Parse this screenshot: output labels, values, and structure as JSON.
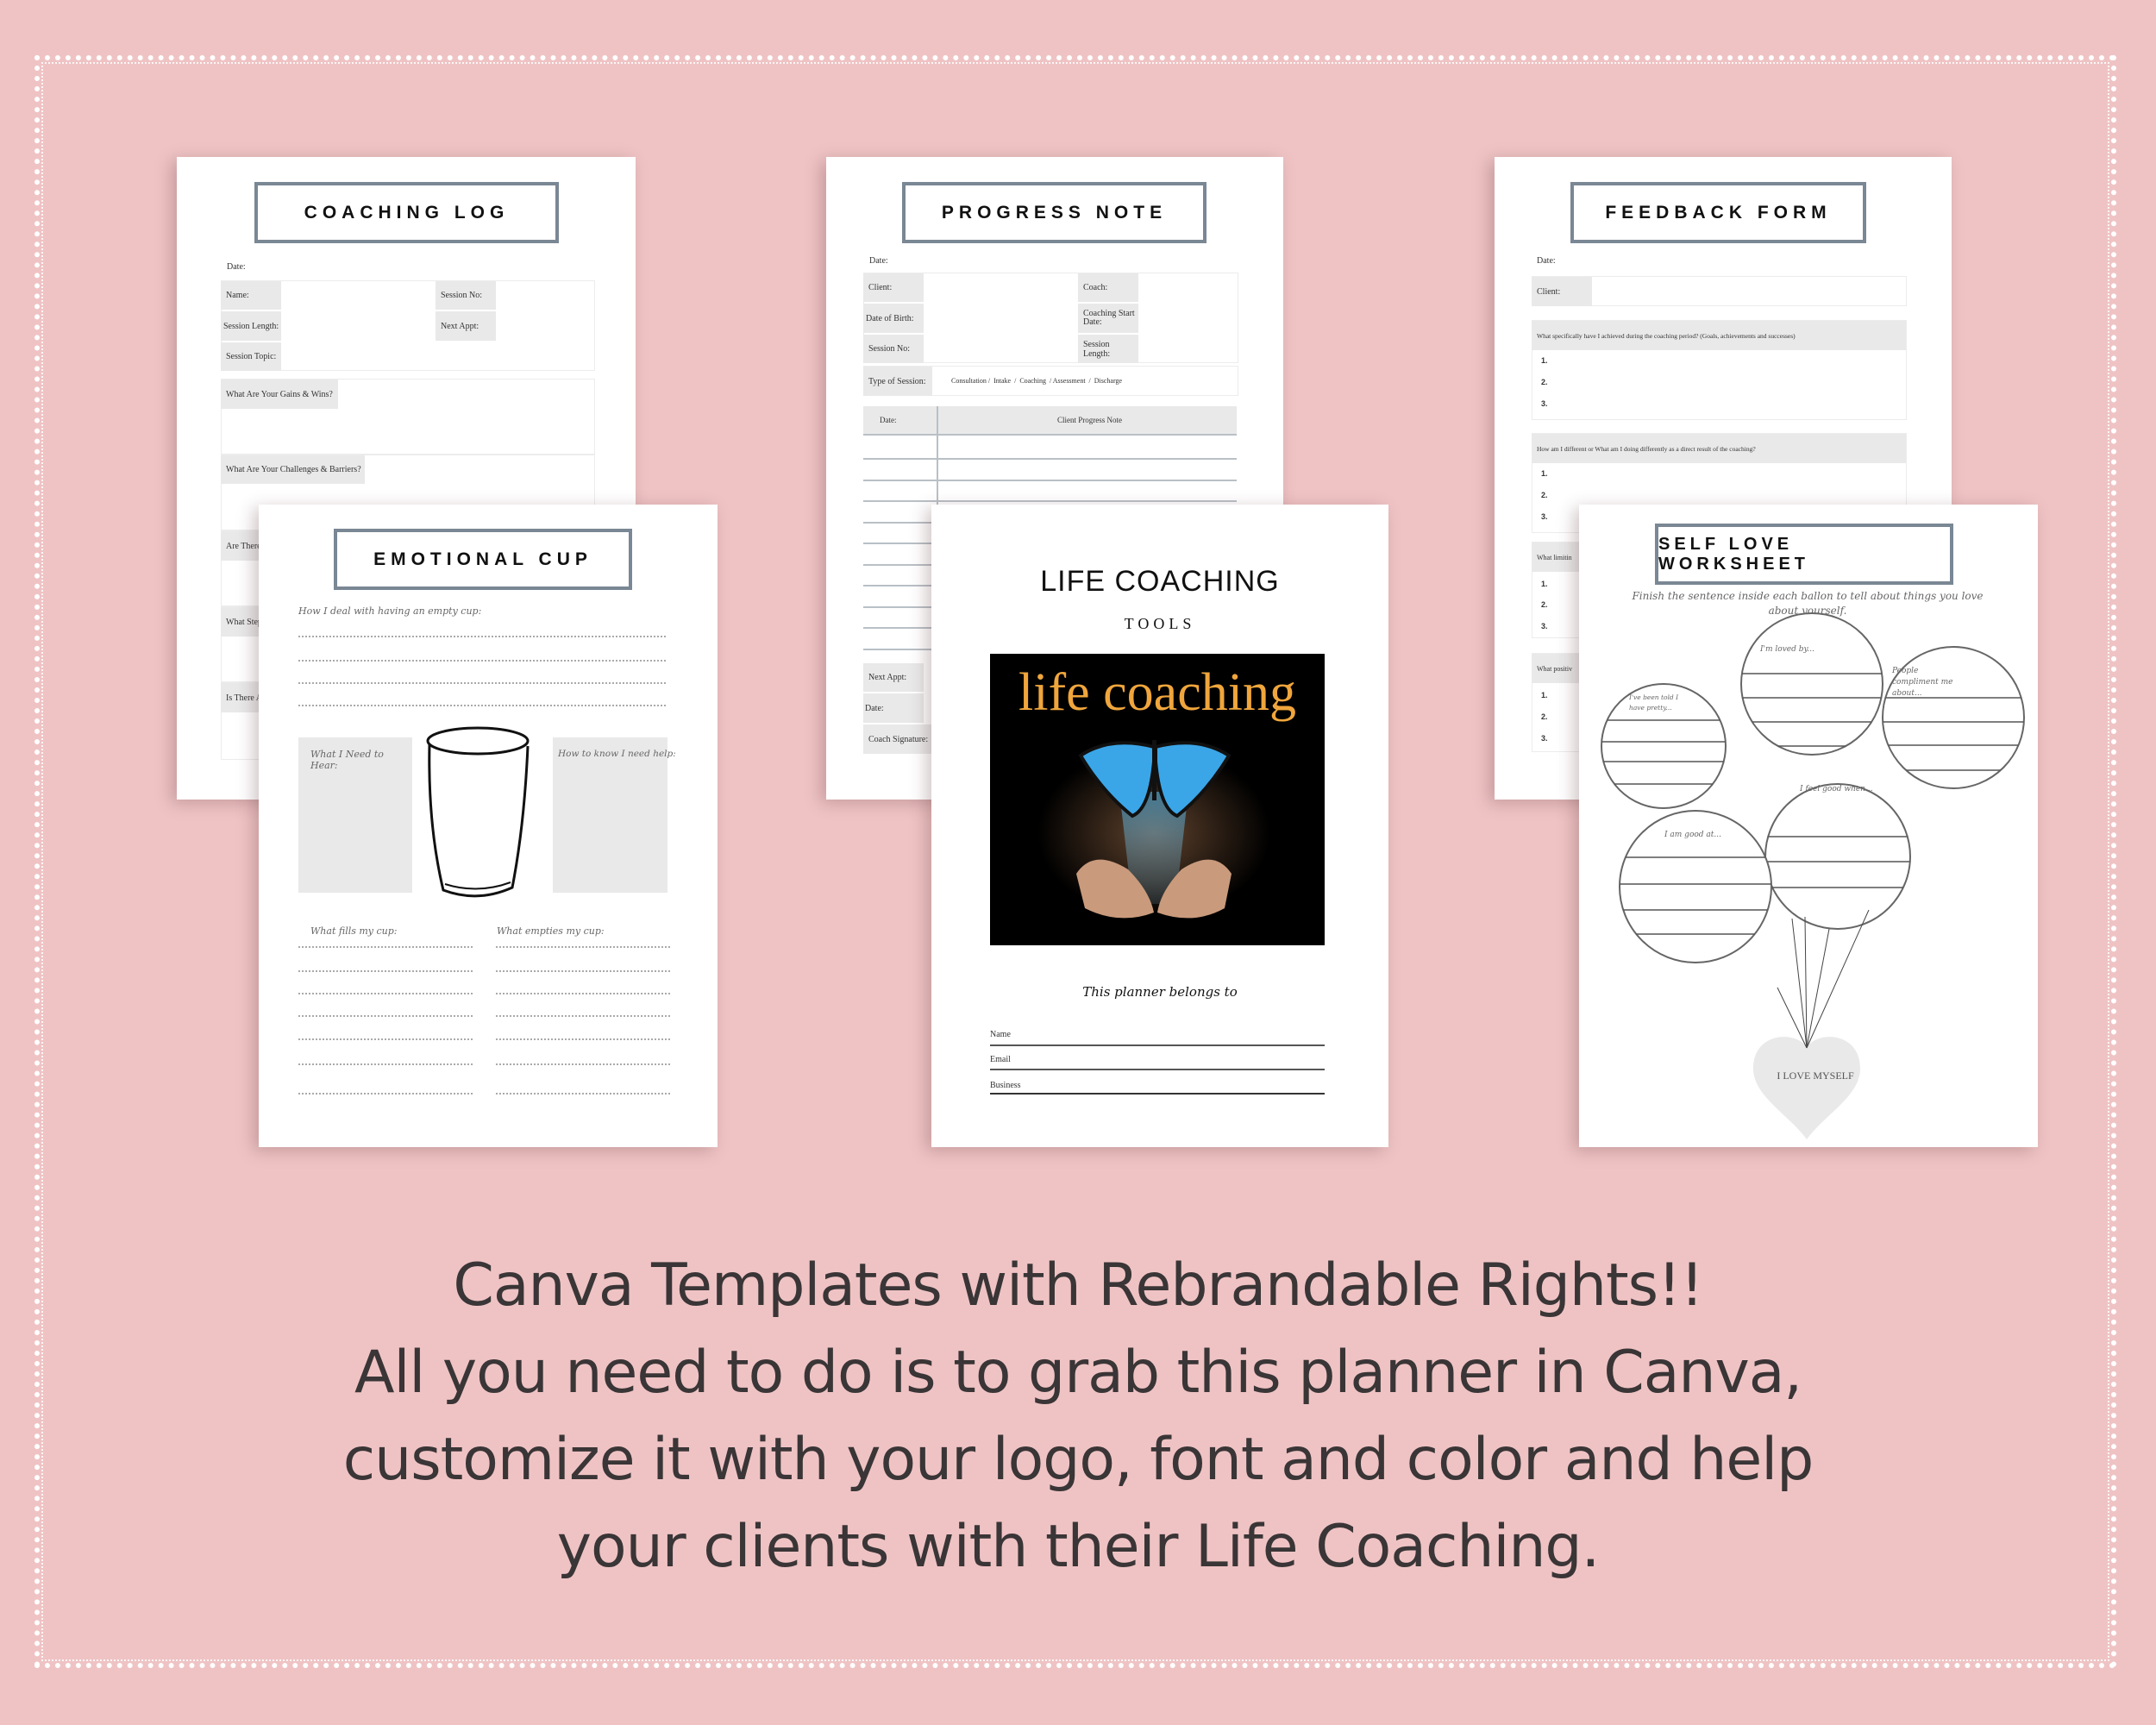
{
  "colors": {
    "background": "#efc3c4",
    "page": "#ffffff",
    "title_border": "#7a8794",
    "label_fill": "#e9e9e9",
    "cover_accent": "#f0a63c",
    "butterfly": "#3aa6e8"
  },
  "coaching_log": {
    "title": "COACHING LOG",
    "date_label": "Date:",
    "fields": [
      {
        "label": "Name:"
      },
      {
        "label": "Session No:"
      },
      {
        "label": "Session Length:"
      },
      {
        "label": "Next Appt:"
      },
      {
        "label": "Session Topic:"
      }
    ],
    "sections": [
      "What Are Your Gains & Wins?",
      "What Are Your Challenges & Barriers?",
      "Are There",
      "What Step",
      "Is There A"
    ]
  },
  "progress_note": {
    "title": "PROGRESS NOTE",
    "date_label": "Date:",
    "fields": [
      "Client:",
      "Coach:",
      "Date of Birth:",
      "Coaching Start Date:",
      "Session No:",
      "Session Length:"
    ],
    "type_label": "Type of Session:",
    "type_options": "Consultation /  Intake  /  Coaching  / Assessment  /  Discharge",
    "table_headers": [
      "Date:",
      "Client Progress Note"
    ],
    "footer_fields": [
      "Next Appt:",
      "Date:",
      "Coach Signature:"
    ]
  },
  "feedback_form": {
    "title": "FEEDBACK FORM",
    "date_label": "Date:",
    "client_label": "Client:",
    "questions": [
      "What specifically have I achieved during the coaching period? (Goals, achievements and successes)",
      "How am I different or What am I doing differently as a direct result of the coaching?",
      "What limitin",
      "What positiv"
    ],
    "numbers": [
      "1.",
      "2.",
      "3."
    ]
  },
  "emotional_cup": {
    "title": "EMOTIONAL CUP",
    "prompt": "How I deal with having an empty cup:",
    "left_box": "What I Need to Hear:",
    "right_box": "How to know I need help:",
    "fills": "What fills my cup:",
    "empties": "What empties my cup:"
  },
  "cover": {
    "title": "LIFE COACHING",
    "subtitle": "TOOLS",
    "image_text": "life coaching",
    "belongs": "This planner belongs to",
    "fields": [
      "Name",
      "Email",
      "Business"
    ]
  },
  "self_love": {
    "title": "SELF LOVE WORKSHEET",
    "instructions": "Finish the sentence inside each ballon to tell about things you love about yourself.",
    "balloons": [
      "I'm loved by...",
      "People compliment me about...",
      "I've been told I have pretty...",
      "I feel good when...",
      "I am good at..."
    ],
    "heart": "I LOVE MYSELF"
  },
  "caption": {
    "lines": [
      "Canva Templates with Rebrandable Rights!!",
      "All you need to do is to grab this planner in Canva,",
      "customize it with your logo, font and color and help",
      "your clients with their Life Coaching."
    ]
  }
}
